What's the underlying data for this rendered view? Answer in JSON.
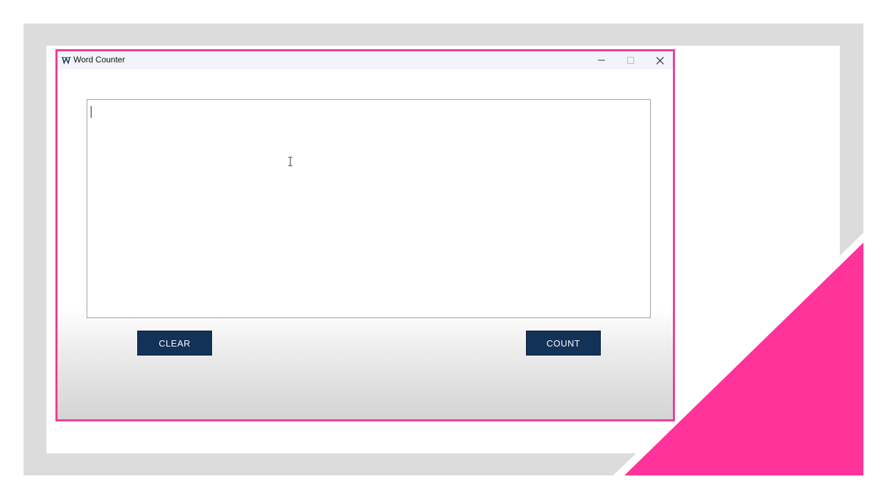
{
  "window": {
    "title": "Word Counter",
    "icon": "w-app-icon",
    "controls": {
      "minimize_icon": "minimize-icon",
      "maximize_icon": "maximize-icon",
      "close_icon": "close-icon"
    }
  },
  "editor": {
    "value": ""
  },
  "buttons": {
    "clear_label": "CLEAR",
    "count_label": "COUNT"
  },
  "colors": {
    "accent_border": "#ee3c96",
    "button_bg": "#123257",
    "frame_gray": "#dcdcdc"
  }
}
